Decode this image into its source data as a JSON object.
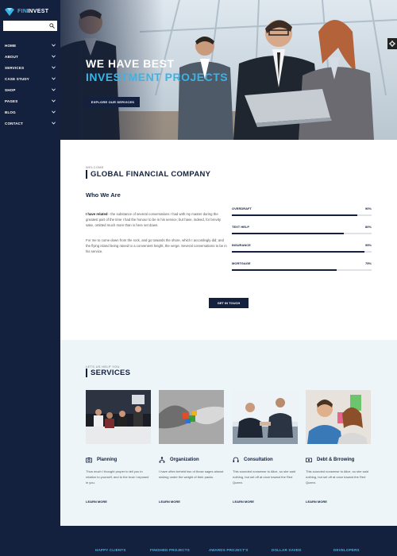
{
  "brand": {
    "name_part1": "FIN",
    "name_part2": "INVEST",
    "accent": "#3ab4e6",
    "navy": "#13213f"
  },
  "search": {
    "placeholder": "",
    "icon": "search-icon"
  },
  "nav": [
    {
      "label": "HOME"
    },
    {
      "label": "ABOUT"
    },
    {
      "label": "SERVICES"
    },
    {
      "label": "CASE STUDY"
    },
    {
      "label": "SHOP"
    },
    {
      "label": "PAGES"
    },
    {
      "label": "BLOG"
    },
    {
      "label": "CONTACT"
    }
  ],
  "hero": {
    "title_line1": "WE HAVE BEST",
    "title_line2": "INVESTMENT PROJECTS",
    "button": "EXPLORE OUR SERVICES"
  },
  "company": {
    "eyebrow": "WELCOME",
    "title": "GLOBAL FINANCIAL COMPANY",
    "subtitle": "Who We Are",
    "para1_lead": "I have related",
    "para1_rest": " - the substance of several conversations I had with my master during the greatest part of the time I had the honour to be in his service; but have, indeed, for brevity sake, omitted much more than is here set down.",
    "para2": "For me to come down from the rock, and go towards the shore, which I accordingly did; and the flying island being raised to a convenient height, the verge. Several conversations to be in his service.",
    "skills": [
      {
        "label": "OVERDRAFT",
        "value": 90,
        "display": "90%"
      },
      {
        "label": "TEXT HELP",
        "value": 80,
        "display": "80%"
      },
      {
        "label": "INSURANCE",
        "value": 95,
        "display": "95%"
      },
      {
        "label": "MORTGAGE",
        "value": 75,
        "display": "75%"
      }
    ],
    "button": "GET IN TOUCH"
  },
  "services": {
    "eyebrow": "LETS US HELP YOU",
    "title": "SERVICES",
    "items": [
      {
        "name": "Planning",
        "icon": "camera-icon",
        "desc": "Thus much I thought proper to tell you in relation to yourself, and to the trust I reposed in you.",
        "link": "LEARN MORE"
      },
      {
        "name": "Organization",
        "icon": "hierarchy-icon",
        "desc": "I have often beheld two of those sages almost sinking under the weight of their packs.",
        "link": "LEARN MORE"
      },
      {
        "name": "Consultation",
        "icon": "headset-icon",
        "desc": "This sounded nonsense to Alice, so she said nothing, but set off at once toward the Red Queen.",
        "link": "LEARN MORE"
      },
      {
        "name": "Debt & Brrowing",
        "icon": "money-icon",
        "desc": "This sounded nonsense to Alice, so she said nothing, but set off at once toward the Red Queen.",
        "link": "LEARN MORE"
      }
    ]
  },
  "stats": [
    {
      "label": "HAPPY CLIENTS"
    },
    {
      "label": "FINISHED PROJECTS"
    },
    {
      "label": "AWARDS PROJECT'S"
    },
    {
      "label": "DOLLAR SAVED"
    },
    {
      "label": "DEVELOPERS"
    }
  ]
}
